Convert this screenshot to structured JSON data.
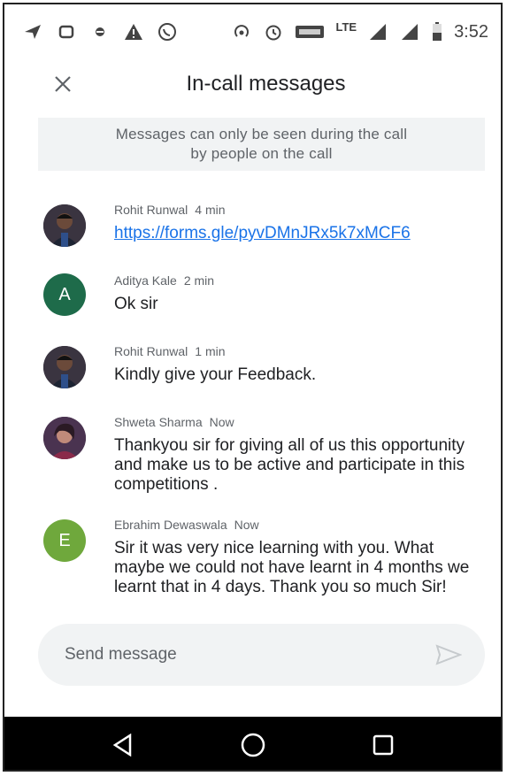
{
  "status_bar": {
    "time": "3:52",
    "network_label": "LTE",
    "left_icons": [
      "navigation-icon",
      "sync-icon",
      "dot-icon",
      "warning-icon",
      "whatsapp-icon"
    ],
    "right_icons": [
      "hotspot-icon",
      "alarm-icon",
      "volte-icon",
      "signal-icon",
      "signal-icon",
      "battery-icon"
    ]
  },
  "header": {
    "title": "In-call messages",
    "close_icon": "close-icon"
  },
  "notice": {
    "line1": "Messages can only be seen during the call",
    "line2": "by people on the call"
  },
  "messages": [
    {
      "sender": "Rohit Runwal",
      "time": "4 min",
      "text": "https://forms.gle/pyvDMnJRx5k7xMCF6",
      "is_link": true,
      "avatar_type": "photo",
      "avatar_letter": ""
    },
    {
      "sender": "Aditya Kale",
      "time": "2 min",
      "text": "Ok sir",
      "is_link": false,
      "avatar_type": "letter",
      "avatar_letter": "A",
      "avatar_color": "#1e6b4a"
    },
    {
      "sender": "Rohit Runwal",
      "time": "1 min",
      "text": "Kindly give your Feedback.",
      "is_link": false,
      "avatar_type": "photo",
      "avatar_letter": ""
    },
    {
      "sender": "Shweta Sharma",
      "time": "Now",
      "text": "Thankyou sir for giving all of us this opportunity and make us to be active and participate in this competitions .",
      "is_link": false,
      "avatar_type": "photo2",
      "avatar_letter": ""
    },
    {
      "sender": "Ebrahim Dewaswala",
      "time": "Now",
      "text": "Sir it was very nice learning with you. What maybe we could not have learnt in 4 months we learnt that in 4 days. Thank you so much Sir!",
      "is_link": false,
      "avatar_type": "letter",
      "avatar_letter": "E",
      "avatar_color": "#6fa83c"
    }
  ],
  "composer": {
    "placeholder": "Send message",
    "send_icon": "send-icon"
  },
  "navbar": {
    "back_icon": "back-triangle-icon",
    "home_icon": "home-circle-icon",
    "recents_icon": "recents-square-icon"
  },
  "colors": {
    "link": "#1a73e8",
    "notice_bg": "#f1f3f4",
    "navbar_bg": "#000000"
  }
}
